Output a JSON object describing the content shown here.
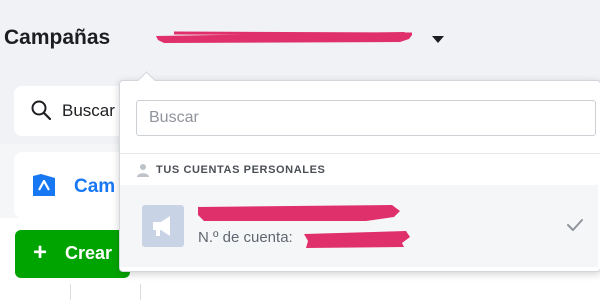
{
  "header": {
    "title": "Campañas",
    "account_selector_icon": "chevron-down-icon"
  },
  "search_card": {
    "label": "Buscar",
    "icon": "search-icon"
  },
  "left_tab": {
    "label": "Cam",
    "icon": "campaign-icon",
    "color": "#1877f2"
  },
  "create_button": {
    "label": "Crear",
    "icon": "plus-icon",
    "color": "#00a400"
  },
  "dropdown": {
    "search_placeholder": "Buscar",
    "section_title": "TUS CUENTAS PERSONALES",
    "section_icon": "person-icon",
    "accounts": [
      {
        "account_id_label": "N.º de cuenta:",
        "avatar_icon": "megaphone-icon",
        "selected_icon": "check-icon"
      }
    ]
  },
  "colors": {
    "redaction": "#e0306b",
    "background": "#f0f2f5"
  }
}
